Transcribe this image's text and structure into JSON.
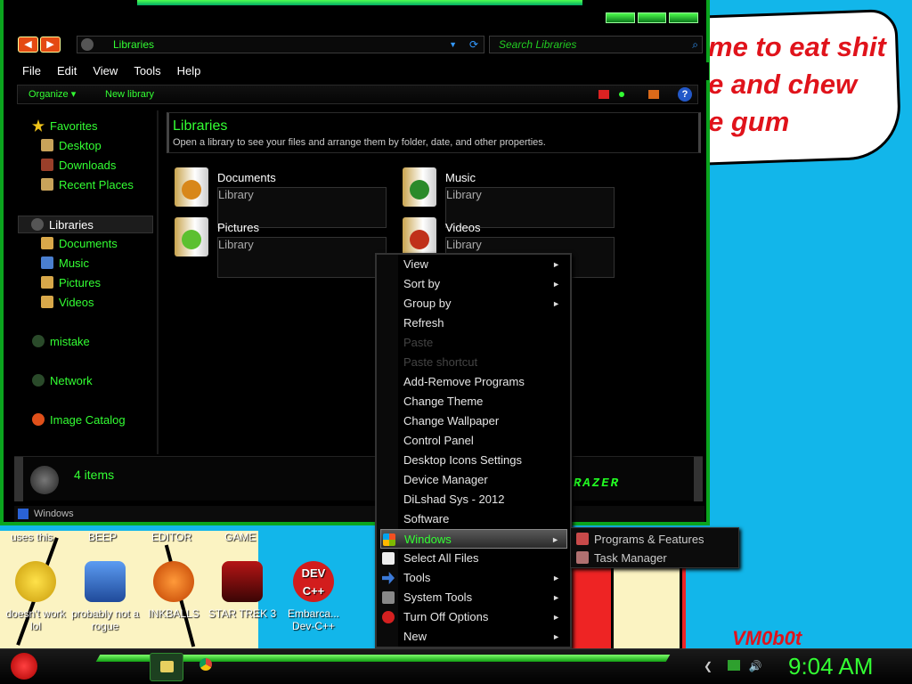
{
  "background": {
    "bubble_text": "me to eat shit\ne and chew\ne gum",
    "signature": "VM0b0t"
  },
  "window": {
    "address": "Libraries",
    "search_placeholder": "Search Libraries",
    "menu": [
      "File",
      "Edit",
      "View",
      "Tools",
      "Help"
    ],
    "commands": {
      "organize": "Organize ▾",
      "new_library": "New library"
    },
    "nav": {
      "favorites": "Favorites",
      "desktop": "Desktop",
      "downloads": "Downloads",
      "recent": "Recent Places",
      "libraries": "Libraries",
      "documents": "Documents",
      "music": "Music",
      "pictures": "Pictures",
      "videos": "Videos",
      "mistake": "mistake",
      "network": "Network",
      "image_catalog": "Image Catalog"
    },
    "header": {
      "title": "Libraries",
      "subtitle": "Open a library to see your files and arrange them by folder, date, and other properties."
    },
    "libraries": [
      {
        "name": "Documents",
        "type": "Library"
      },
      {
        "name": "Music",
        "type": "Library"
      },
      {
        "name": "Pictures",
        "type": "Library"
      },
      {
        "name": "Videos",
        "type": "Library"
      }
    ],
    "status_count": "4 items",
    "brand": "RAZER",
    "footer": "Windows"
  },
  "context_menu": [
    {
      "label": "View",
      "arrow": "►"
    },
    {
      "label": "Sort by",
      "arrow": "►"
    },
    {
      "label": "Group by",
      "arrow": "►"
    },
    {
      "label": "Refresh",
      "arrow": ""
    },
    {
      "label": "Paste",
      "arrow": ""
    },
    {
      "label": "Paste shortcut",
      "arrow": ""
    },
    {
      "label": "Add-Remove Programs",
      "arrow": ""
    },
    {
      "label": "Change Theme",
      "arrow": ""
    },
    {
      "label": "Change Wallpaper",
      "arrow": ""
    },
    {
      "label": "Control Panel",
      "arrow": ""
    },
    {
      "label": "Desktop Icons Settings",
      "arrow": ""
    },
    {
      "label": "Device Manager",
      "arrow": ""
    },
    {
      "label": "DiLshad Sys - 2012",
      "arrow": ""
    },
    {
      "label": "Software",
      "arrow": ""
    },
    {
      "label": "Windows",
      "arrow": "►"
    },
    {
      "label": "Select All Files",
      "arrow": ""
    },
    {
      "label": "Tools",
      "arrow": "►"
    },
    {
      "label": "System Tools",
      "arrow": "►"
    },
    {
      "label": "Turn Off Options",
      "arrow": "►"
    },
    {
      "label": "New",
      "arrow": "►"
    }
  ],
  "submenu": [
    {
      "label": "Programs & Features"
    },
    {
      "label": "Task Manager"
    }
  ],
  "desktop": {
    "top_labels": [
      "uses this",
      "BEEP",
      "EDITOR",
      "GAME"
    ],
    "icons": [
      {
        "label": "doesn't work lol"
      },
      {
        "label": "probably not a rogue"
      },
      {
        "label": "INKBALLS"
      },
      {
        "label": "STAR TREK 3"
      },
      {
        "label": "Embarca... Dev-C++"
      }
    ]
  },
  "taskbar": {
    "time": "9:04 AM"
  }
}
